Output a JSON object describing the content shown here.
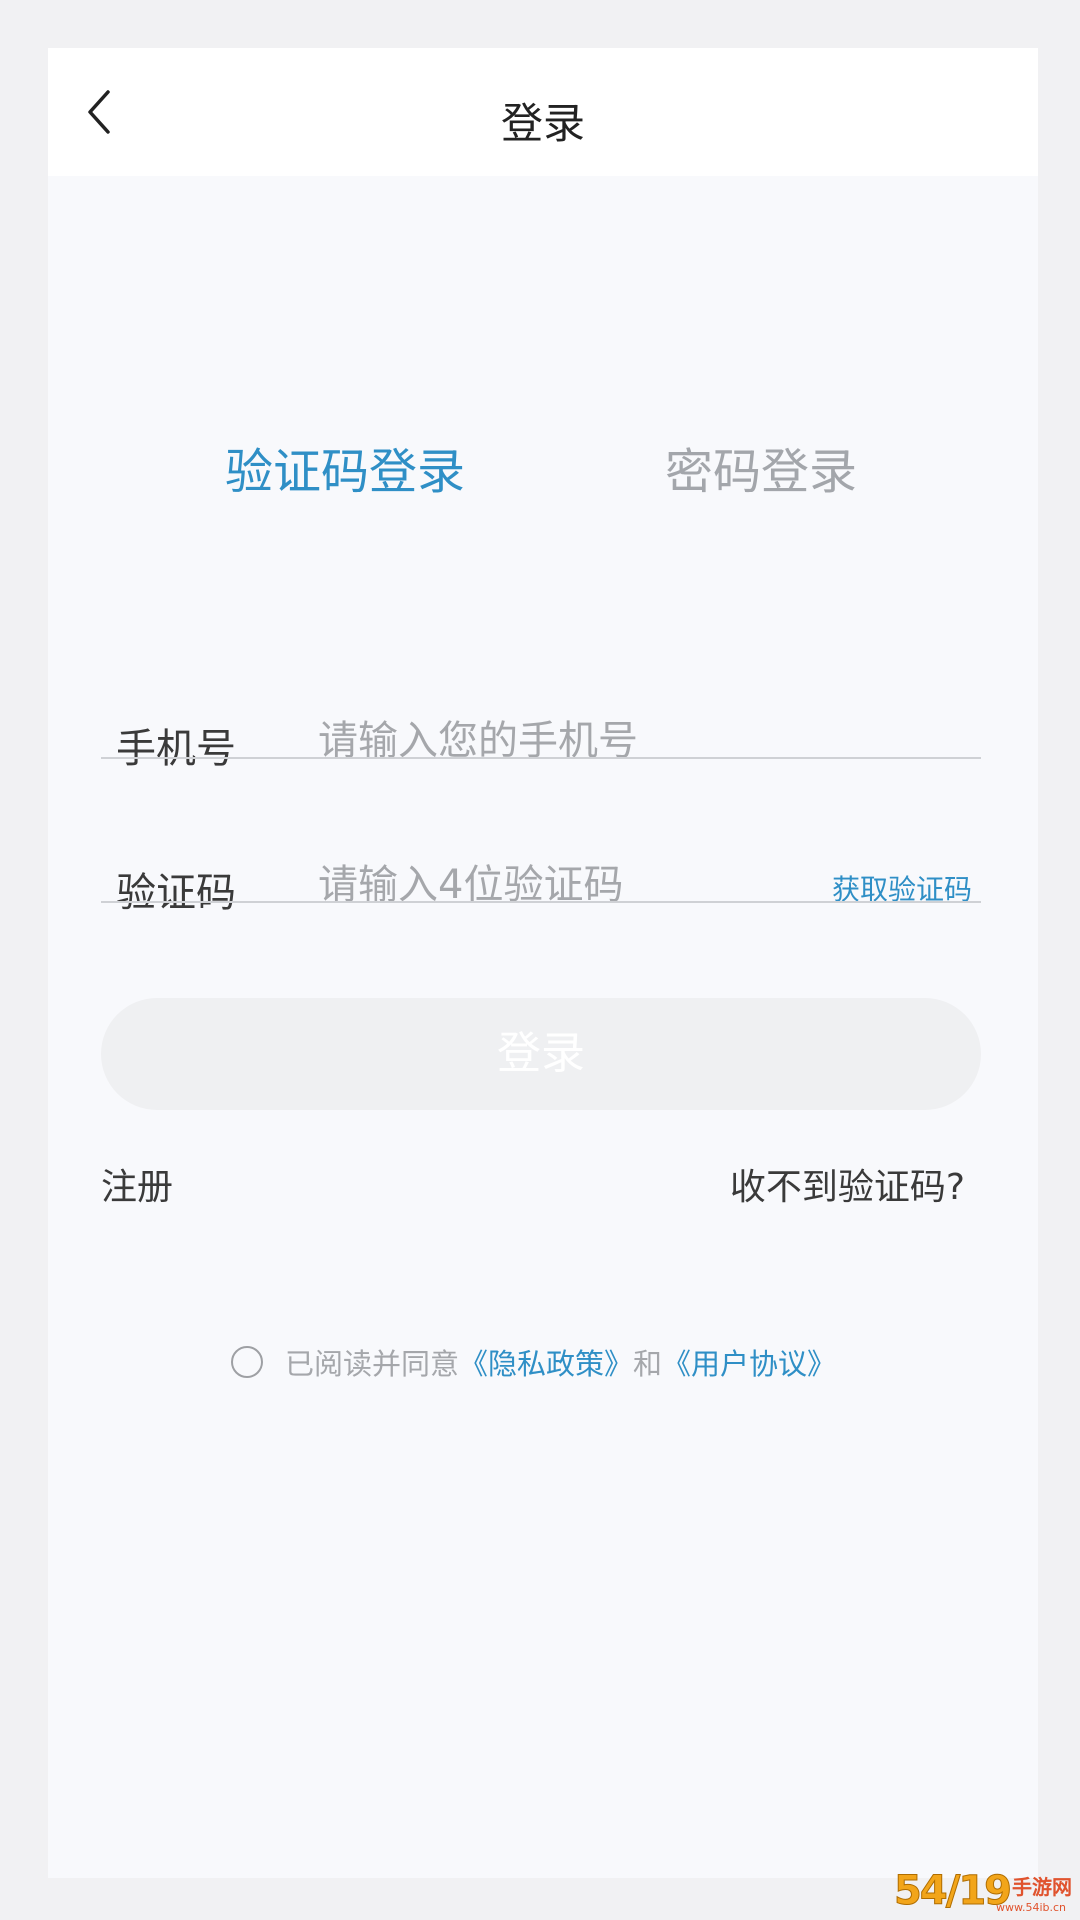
{
  "header": {
    "title": "登录",
    "back_icon": "chevron-left-icon"
  },
  "tabs": [
    {
      "label": "验证码登录",
      "active": true
    },
    {
      "label": "密码登录",
      "active": false
    }
  ],
  "form": {
    "phone": {
      "label": "手机号",
      "placeholder": "请输入您的手机号",
      "value": ""
    },
    "code": {
      "label": "验证码",
      "placeholder": "请输入4位验证码",
      "value": "",
      "get_code_label": "获取验证码"
    },
    "login_button": "登录"
  },
  "links": {
    "register": "注册",
    "no_code": "收不到验证码?"
  },
  "agreement": {
    "checked": false,
    "prefix": "已阅读并同意",
    "privacy_link": "《隐私政策》",
    "conjunction": "和",
    "user_agreement_link": "《用户协议》"
  },
  "watermark": {
    "number": "54",
    "slash": "/",
    "suffix": "19",
    "site": "手游网",
    "domain": "www.54ib.cn"
  },
  "colors": {
    "accent": "#2f8fc6",
    "inactive_tab": "#a3a6ab",
    "placeholder": "#a5a7ab",
    "button_disabled_bg": "#eff0f2",
    "page_bg": "#f8f9fc"
  }
}
